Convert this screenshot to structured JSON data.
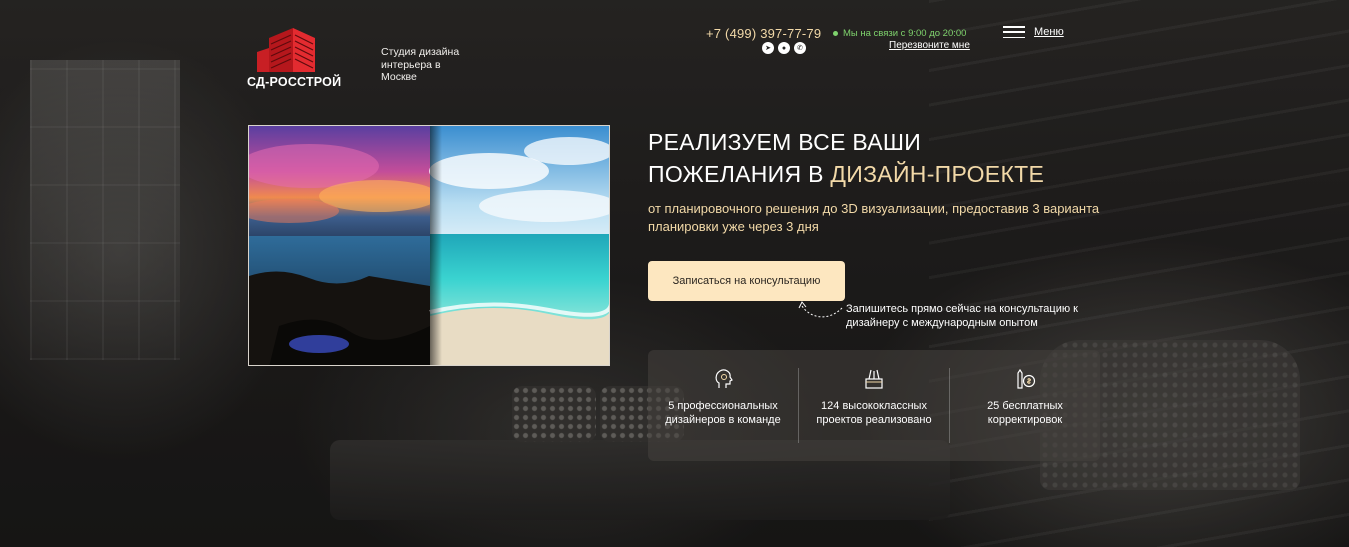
{
  "header": {
    "logo_text": "СД-РОССТРОЙ",
    "studio_text": "Студия дизайна интерьера в Москве",
    "phone": "+7 (499) 397-77-79",
    "messengers": [
      {
        "icon": "telegram-icon",
        "glyph": "➤"
      },
      {
        "icon": "viber-icon",
        "glyph": "●"
      },
      {
        "icon": "whatsapp-icon",
        "glyph": "✆"
      }
    ],
    "online_status": "Мы на связи с 9:00 до 20:00",
    "callback_link": "Перезвоните мне",
    "menu_label": "Меню"
  },
  "hero": {
    "headline_line1": "РЕАЛИЗУЕМ ВСЕ ВАШИ",
    "headline_line2_plain": "ПОЖЕЛАНИЯ В ",
    "headline_line2_accent": "ДИЗАЙН-ПРОЕКТЕ",
    "subheadline": "от планировочного решения до 3D визуализации, предоставив 3 варианта планировки уже через 3 дня",
    "cta_button": "Записаться на консультацию",
    "cta_note": "Запишитесь прямо сейчас на консультацию к дизайнеру с международным опытом"
  },
  "features": [
    {
      "icon": "designer-head-icon",
      "text": "5 профессиональных дизайнеров в команде"
    },
    {
      "icon": "drawing-tools-icon",
      "text": "124 высококлассных проектов реализовано"
    },
    {
      "icon": "pencil-coin-icon",
      "text": "25 бесплатных корректировок"
    }
  ],
  "colors": {
    "accent": "#f2d9a8",
    "cta_background": "#fde7c0",
    "online_green": "#7fd36d",
    "logo_red": "#d3262b"
  }
}
